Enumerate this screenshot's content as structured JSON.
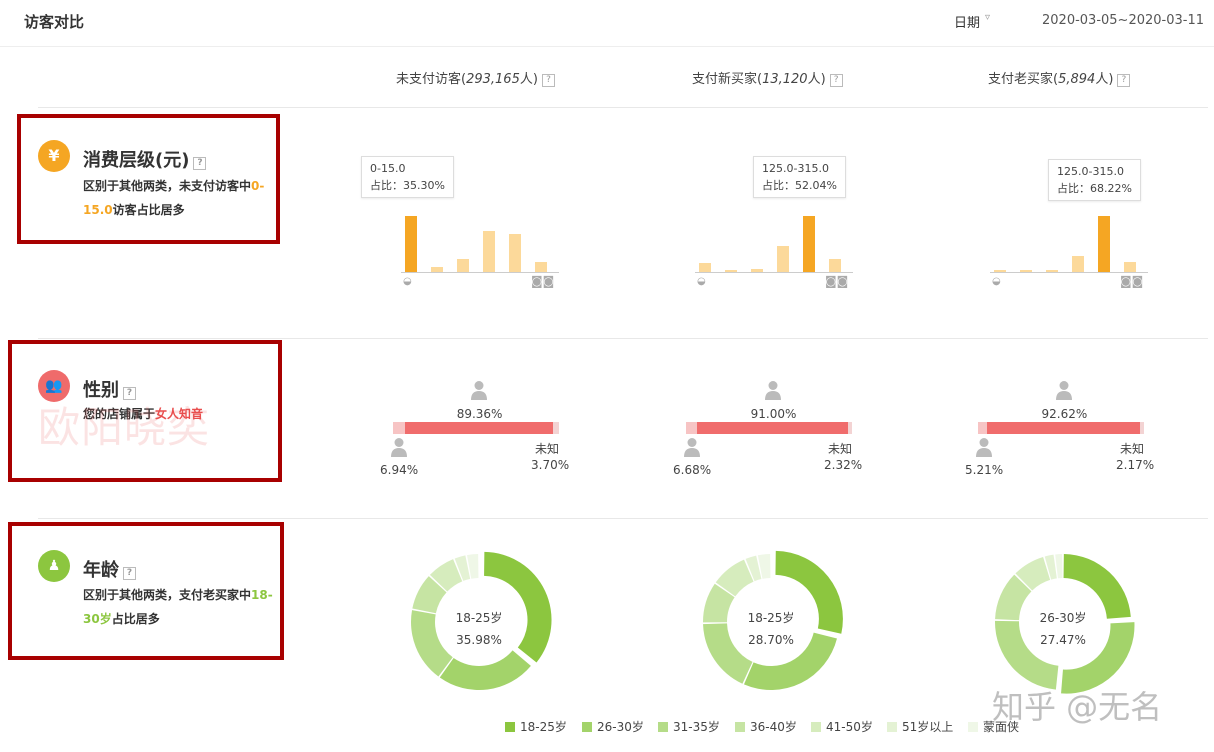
{
  "header": {
    "title": "访客对比",
    "date_label": "日期",
    "date_range": "2020-03-05~2020-03-11"
  },
  "columns": [
    {
      "label": "未支付访客",
      "count": "293,165"
    },
    {
      "label": "支付新买家",
      "count": "13,120"
    },
    {
      "label": "支付老买家",
      "count": "5,894"
    }
  ],
  "person_unit": "人",
  "help_mark": "?",
  "sections": {
    "consumption": {
      "icon": "yen-icon",
      "icon_char": "¥",
      "title": "消费层级(元)",
      "desc_pre": "区别于其他两类，未支付访客中",
      "desc_hl": "0-15.0",
      "desc_post": "访客占比居多",
      "color": "#f5a623"
    },
    "gender": {
      "icon": "users-icon",
      "title": "性别",
      "desc_pre": "您的店铺属于",
      "desc_hl": "女人知音",
      "desc_post": "",
      "color": "#e94e4e"
    },
    "age": {
      "icon": "family-icon",
      "title": "年龄",
      "desc_pre": "区别于其他两类，支付老买家中",
      "desc_hl": "18-30岁",
      "desc_post": "占比居多",
      "color": "#8cc63f"
    }
  },
  "consumption_charts": [
    {
      "tooltip_range": "0-15.0",
      "tooltip_ratio": "占比：35.30%",
      "values": [
        35.3,
        3.0,
        8.0,
        26.0,
        24.0,
        6.0
      ],
      "highlight": 0
    },
    {
      "tooltip_range": "125.0-315.0",
      "tooltip_ratio": "占比：52.04%",
      "values": [
        8.0,
        1.5,
        3.0,
        24.0,
        52.04,
        12.0
      ],
      "highlight": 4
    },
    {
      "tooltip_range": "125.0-315.0",
      "tooltip_ratio": "占比：68.22%",
      "values": [
        1.5,
        1.5,
        1.5,
        20.0,
        68.22,
        12.0
      ],
      "highlight": 4
    }
  ],
  "gender_charts": [
    {
      "female": "89.36%",
      "male": "6.94%",
      "unknown_label": "未知",
      "unknown": "3.70%",
      "female_v": 89.36,
      "male_v": 6.94,
      "unknown_v": 3.7
    },
    {
      "female": "91.00%",
      "male": "6.68%",
      "unknown_label": "未知",
      "unknown": "2.32%",
      "female_v": 91.0,
      "male_v": 6.68,
      "unknown_v": 2.32
    },
    {
      "female": "92.62%",
      "male": "5.21%",
      "unknown_label": "未知",
      "unknown": "2.17%",
      "female_v": 92.62,
      "male_v": 5.21,
      "unknown_v": 2.17
    }
  ],
  "age_charts": [
    {
      "center_label": "18-25岁",
      "center_pct": "35.98%",
      "values": [
        35.98,
        24.0,
        18.0,
        9.0,
        7.0,
        3.0,
        3.02
      ],
      "highlight": 0
    },
    {
      "center_label": "18-25岁",
      "center_pct": "28.70%",
      "values": [
        28.7,
        28.0,
        18.0,
        10.0,
        9.0,
        3.0,
        3.3
      ],
      "highlight": 0
    },
    {
      "center_label": "26-30岁",
      "center_pct": "27.47%",
      "values": [
        24.0,
        27.47,
        24.0,
        12.0,
        8.0,
        2.5,
        2.03
      ],
      "highlight": 1
    }
  ],
  "age_legend": [
    {
      "label": "18-25岁",
      "color": "#8cc63f"
    },
    {
      "label": "26-30岁",
      "color": "#a3d36a"
    },
    {
      "label": "31-35岁",
      "color": "#b5dc88"
    },
    {
      "label": "36-40岁",
      "color": "#c6e4a3"
    },
    {
      "label": "41-50岁",
      "color": "#d6ecbd"
    },
    {
      "label": "51岁以上",
      "color": "#e4f2d4"
    },
    {
      "label": "蒙面侠",
      "color": "#eff7e7"
    }
  ],
  "watermark": "欧阳晓奕",
  "site_watermark": "知乎 @无名",
  "colors": {
    "bar_main": "#f5a623",
    "bar_light": "#fcd99a",
    "female": "#f06c6c",
    "male": "#f7c4c4",
    "unknown": "#f3d3d3"
  }
}
